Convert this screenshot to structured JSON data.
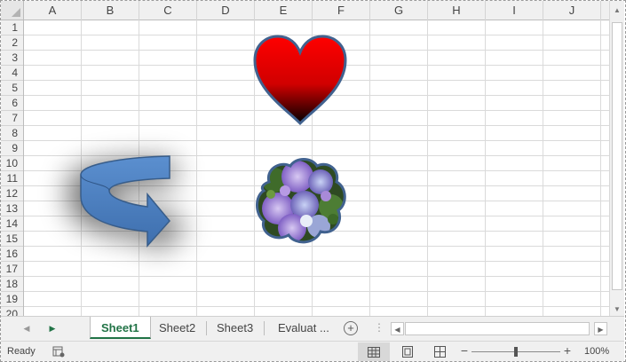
{
  "grid": {
    "columns": [
      "A",
      "B",
      "C",
      "D",
      "E",
      "F",
      "G",
      "H",
      "I",
      "J"
    ],
    "rows": [
      "1",
      "2",
      "3",
      "4",
      "5",
      "6",
      "7",
      "8",
      "9",
      "10",
      "11",
      "12",
      "13",
      "14",
      "15",
      "16",
      "17",
      "18",
      "19",
      "20"
    ]
  },
  "shapes": {
    "heart": {
      "fill_top": "#ff0000",
      "fill_bottom": "#000000",
      "outline": "#41628f"
    },
    "arrow": {
      "fill": "#4f81bd",
      "outline": "#385d8a"
    },
    "flower_picture": {
      "outline": "#41628f"
    }
  },
  "sheets": {
    "tabs": [
      "Sheet1",
      "Sheet2",
      "Sheet3",
      "Evaluat ..."
    ],
    "active": "Sheet1",
    "active_color": "#217346"
  },
  "status": {
    "ready": "Ready",
    "zoom": "100%"
  }
}
